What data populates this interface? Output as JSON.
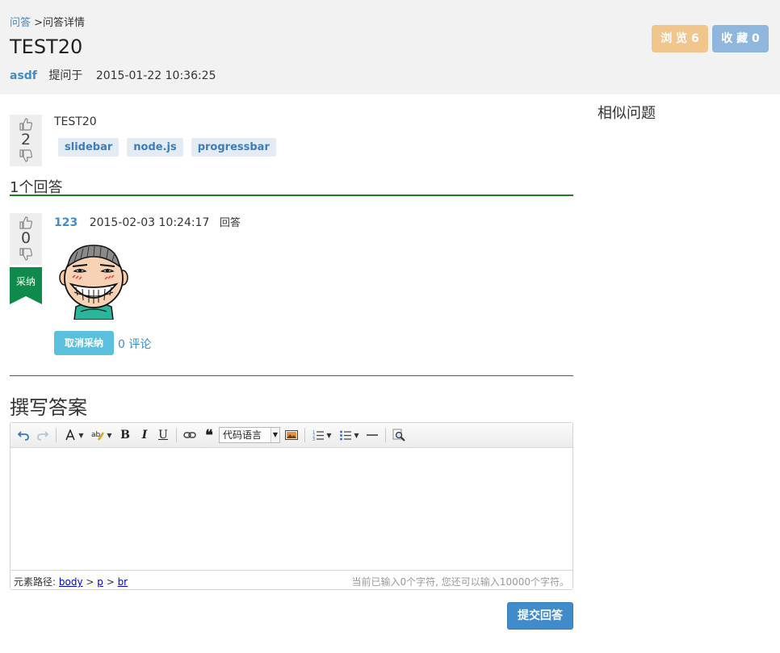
{
  "breadcrumb": {
    "root": "问答",
    "separator": " >",
    "current": "问答详情"
  },
  "question": {
    "title": "TEST20",
    "author": "asdf",
    "asked_label": "提问于",
    "asked_time": "2015-01-22 10:36:25",
    "body": "TEST20",
    "votes": "2",
    "tags": [
      "slidebar",
      "node.js",
      "progressbar"
    ]
  },
  "header_buttons": {
    "views": "浏 览 6",
    "favorites": "收 藏 0"
  },
  "sidebar": {
    "title": "相似问题"
  },
  "answers": {
    "heading": "1个回答",
    "items": [
      {
        "user": "123",
        "time": "2015-02-03 10:24:17",
        "verb": "回答",
        "votes": "0",
        "accepted_label": "采纳",
        "unaccept_button": "取消采纳",
        "comments_link": "0 评论"
      }
    ]
  },
  "write_answer": {
    "title": "撰写答案",
    "code_language_select": "代码语言",
    "status_path_label": "元素路径:",
    "status_path": [
      "body",
      "p",
      "br"
    ],
    "status_path_sep": " > ",
    "word_count": "当前已输入0个字符, 您还可以输入10000个字符。",
    "submit": "提交回答"
  },
  "icons": {
    "vote_up": "thumb-up-icon",
    "vote_down": "thumb-down-icon",
    "undo": "undo-icon",
    "redo": "redo-icon",
    "font_color": "font-color-icon",
    "highlight": "highlight-icon",
    "bold": "bold-icon",
    "italic": "italic-icon",
    "underline": "underline-icon",
    "link": "link-icon",
    "quote": "quote-icon",
    "image": "image-icon",
    "ordered_list": "ordered-list-icon",
    "unordered_list": "unordered-list-icon",
    "horizontal_rule": "horizontal-rule-icon",
    "search": "search-replace-icon"
  },
  "colors": {
    "link": "#428bca",
    "accent_green": "#1e7b1e",
    "accepted_ribbon": "#0e8a4a",
    "views_button": "#f0c68d",
    "favorites_button": "#8fb7dd",
    "unaccept_button": "#5bc0de",
    "submit_button": "#428bca"
  }
}
